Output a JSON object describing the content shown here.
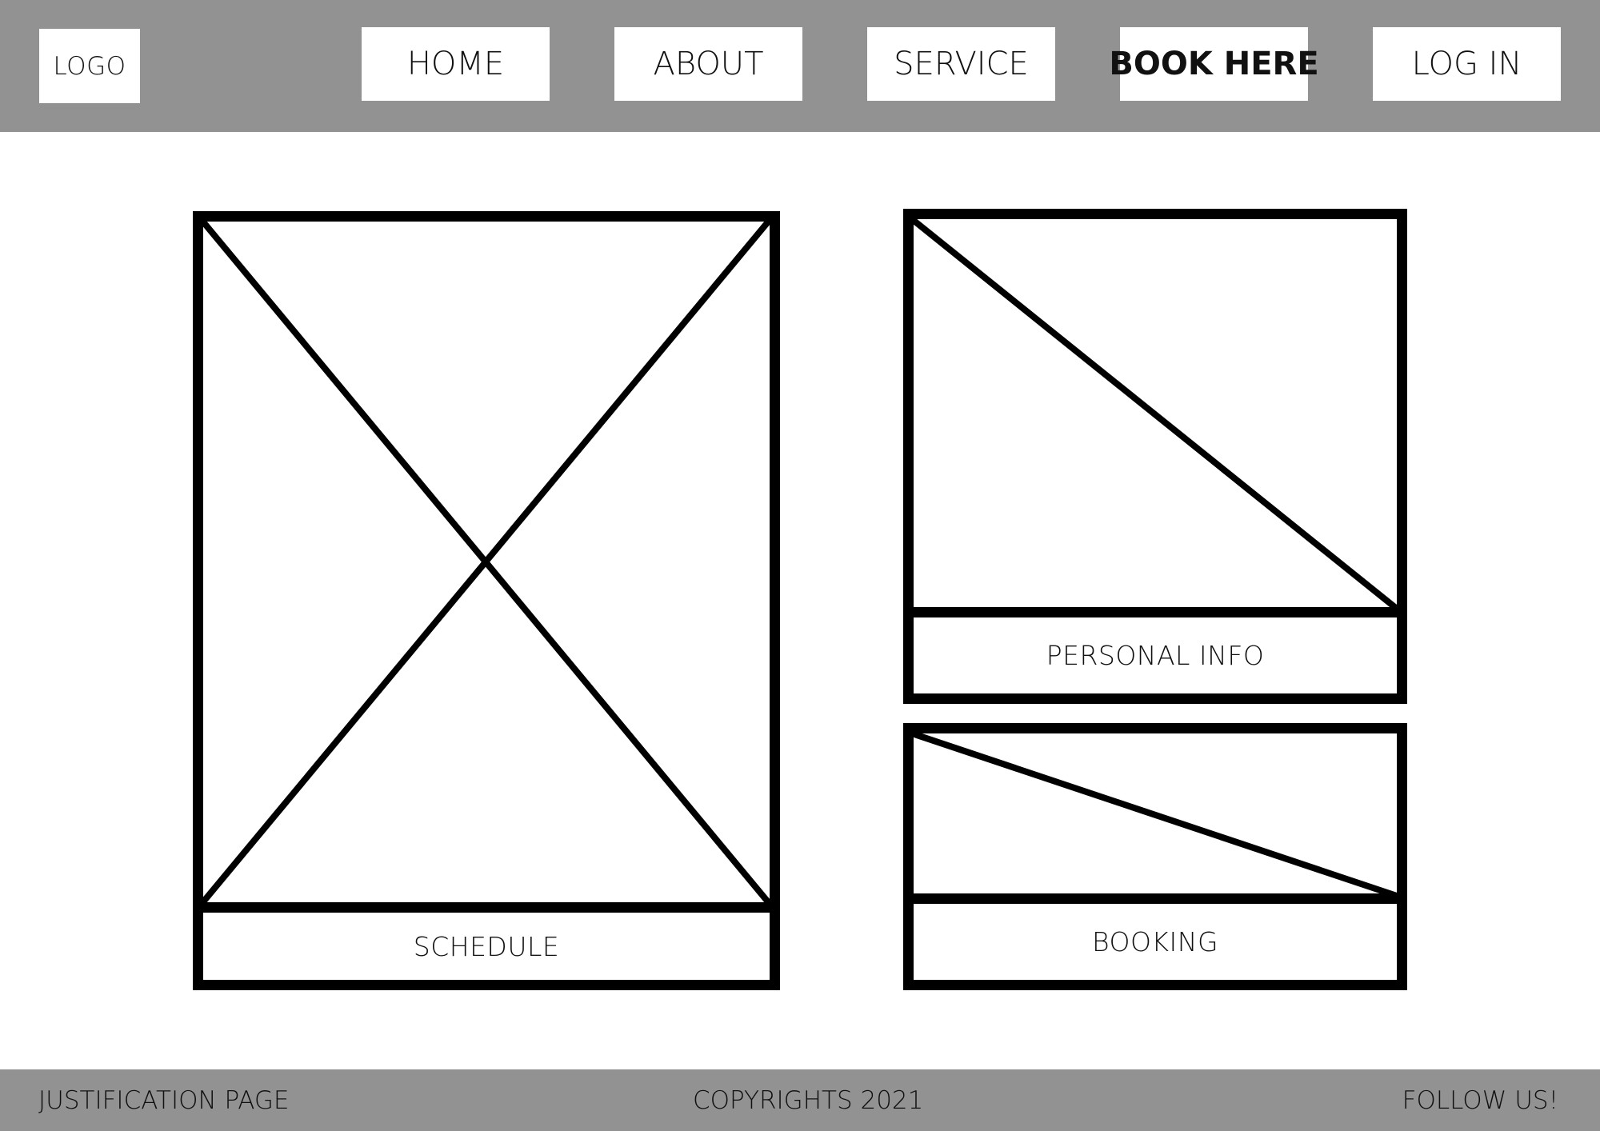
{
  "header": {
    "logo": "LOGO",
    "nav": [
      {
        "label": "HOME"
      },
      {
        "label": "ABOUT"
      },
      {
        "label": "SERVICE"
      },
      {
        "label": "BOOK HERE"
      },
      {
        "label": "LOG IN"
      }
    ]
  },
  "main": {
    "schedule_label": "SCHEDULE",
    "personal_info_label": "PERSONAL INFO",
    "booking_label": "BOOKING"
  },
  "footer": {
    "left": "JUSTIFICATION PAGE",
    "center": "COPYRIGHTS 2021",
    "right": "FOLLOW US!"
  },
  "colors": {
    "bar_gray": "#929292",
    "wire_black": "#000000",
    "background": "#ffffff"
  }
}
